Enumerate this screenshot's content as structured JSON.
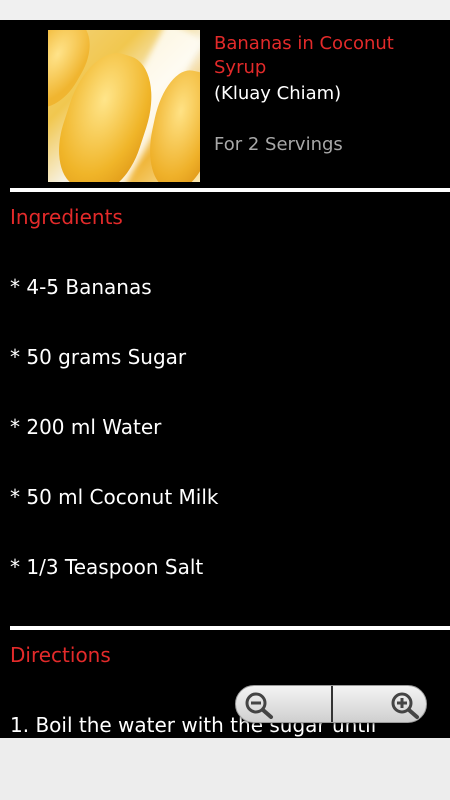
{
  "recipe": {
    "title": "Bananas in Coconut Syrup",
    "subtitle": "(Kluay Chiam)",
    "servings": "For 2 Servings",
    "photo_alt": "Bananas in coconut syrup photo"
  },
  "ingredients": {
    "heading": "Ingredients",
    "items": [
      "* 4-5 Bananas",
      "* 50 grams Sugar",
      "* 200 ml Water",
      "* 50 ml Coconut Milk",
      "* 1/3 Teaspoon Salt"
    ]
  },
  "directions": {
    "heading": "Directions",
    "steps": [
      "1. Boil the water with the sugar until"
    ]
  },
  "zoom": {
    "out_icon": "zoom-out-icon",
    "in_icon": "zoom-in-icon"
  },
  "colors": {
    "accent_red": "#e32a2a",
    "background": "#000000",
    "text": "#ffffff",
    "muted": "#a8a8a8"
  }
}
